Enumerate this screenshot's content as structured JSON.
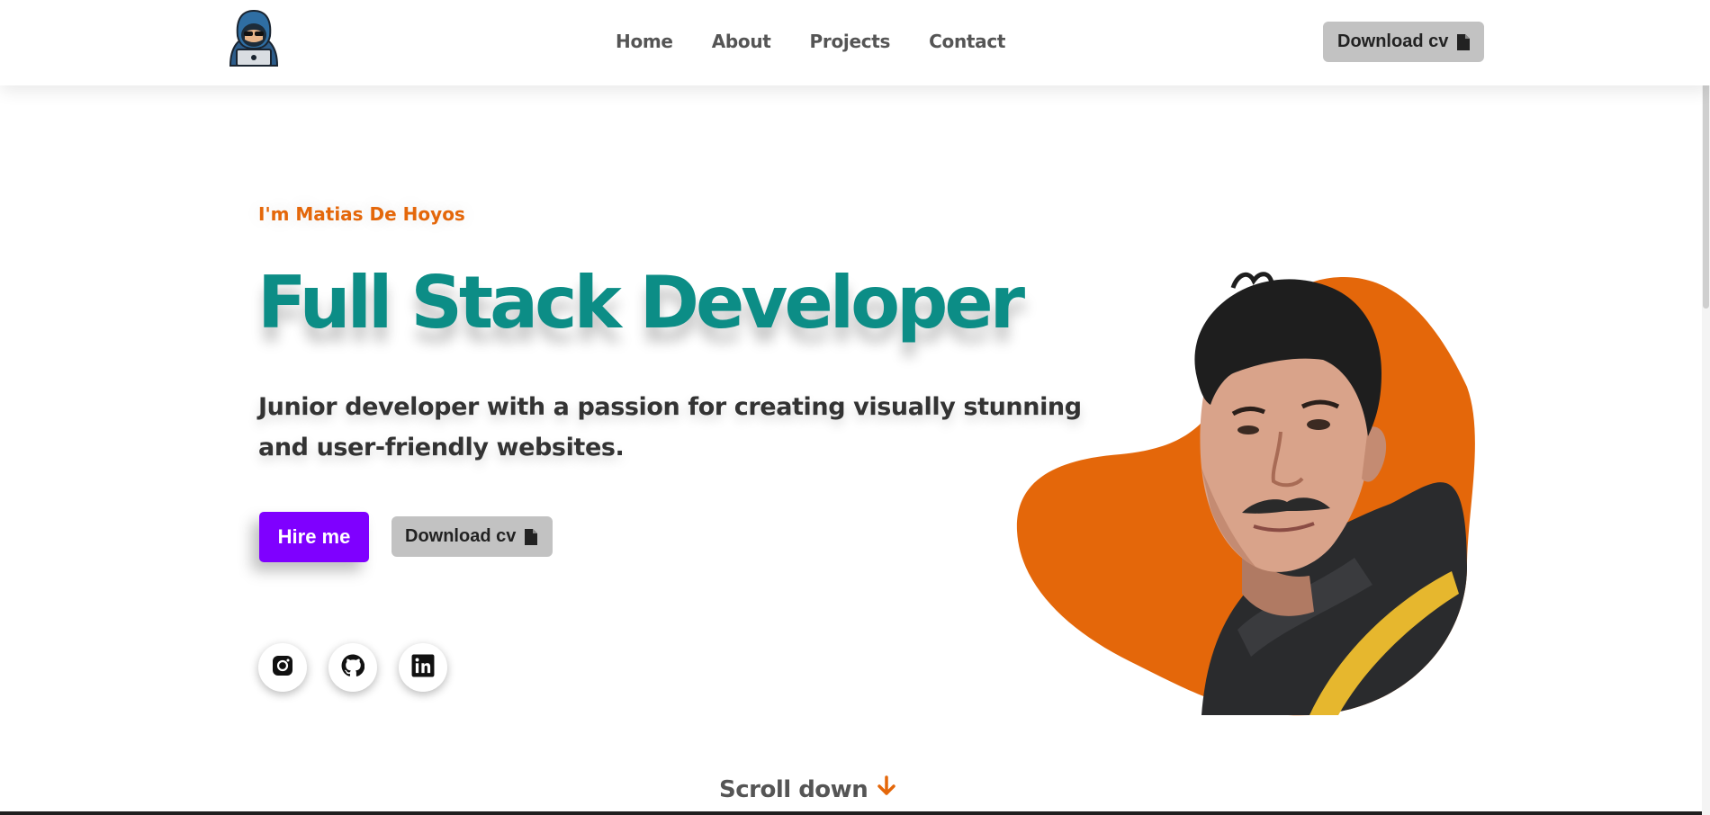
{
  "header": {
    "nav": [
      {
        "label": "Home"
      },
      {
        "label": "About"
      },
      {
        "label": "Projects"
      },
      {
        "label": "Contact"
      }
    ],
    "download_cv_label": "Download cv"
  },
  "hero": {
    "intro": "I'm Matias De Hoyos",
    "headline": "Full Stack Developer",
    "tagline": "Junior developer with a passion for creating visually stunning and user-friendly websites.",
    "hire_label": "Hire me",
    "download_cv_label": "Download cv"
  },
  "socials": [
    {
      "icon": "instagram-icon"
    },
    {
      "icon": "github-icon"
    },
    {
      "icon": "linkedin-icon"
    }
  ],
  "scroll_label": "Scroll down",
  "colors": {
    "accent_orange": "#e4670a",
    "headline_teal": "#0c8d86",
    "hire_purple": "#7f00ff",
    "button_gray": "#c2c2c2"
  }
}
